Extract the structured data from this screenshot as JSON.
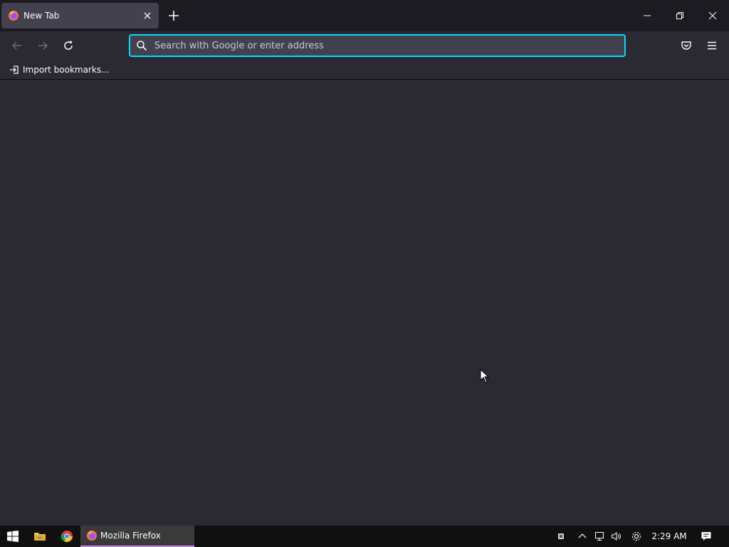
{
  "browser": {
    "tab": {
      "title": "New Tab",
      "close_icon": "close-icon",
      "favicon": "firefox-icon"
    },
    "new_tab_icon": "plus-icon",
    "window_controls": [
      "minimize-icon",
      "restore-icon",
      "close-icon"
    ]
  },
  "navbar": {
    "back_icon": "back-arrow-icon",
    "forward_icon": "forward-arrow-icon",
    "reload_icon": "reload-icon",
    "urlbar": {
      "placeholder": "Search with Google or enter address",
      "value": "",
      "icon": "search-icon"
    },
    "pocket_icon": "pocket-icon",
    "menu_icon": "hamburger-menu-icon"
  },
  "bookmarks": {
    "import_label": "Import bookmarks...",
    "import_icon": "import-icon"
  },
  "taskbar": {
    "start_icon": "windows-start-icon",
    "pinned": [
      "file-explorer-icon",
      "chrome-icon"
    ],
    "active_app": {
      "label": "Mozilla Firefox",
      "icon": "firefox-icon"
    },
    "tray": {
      "icons": [
        "tray-app-icon",
        "chevron-up-icon",
        "network-icon",
        "volume-icon",
        "settings-icon"
      ],
      "clock": "2:29 AM",
      "notification_icon": "action-center-icon"
    }
  },
  "colors": {
    "accent": "#00ddff",
    "toolbar": "#2b2a33",
    "tabstrip": "#1c1b22",
    "selected_tab": "#42414d",
    "taskbar": "#101010"
  }
}
